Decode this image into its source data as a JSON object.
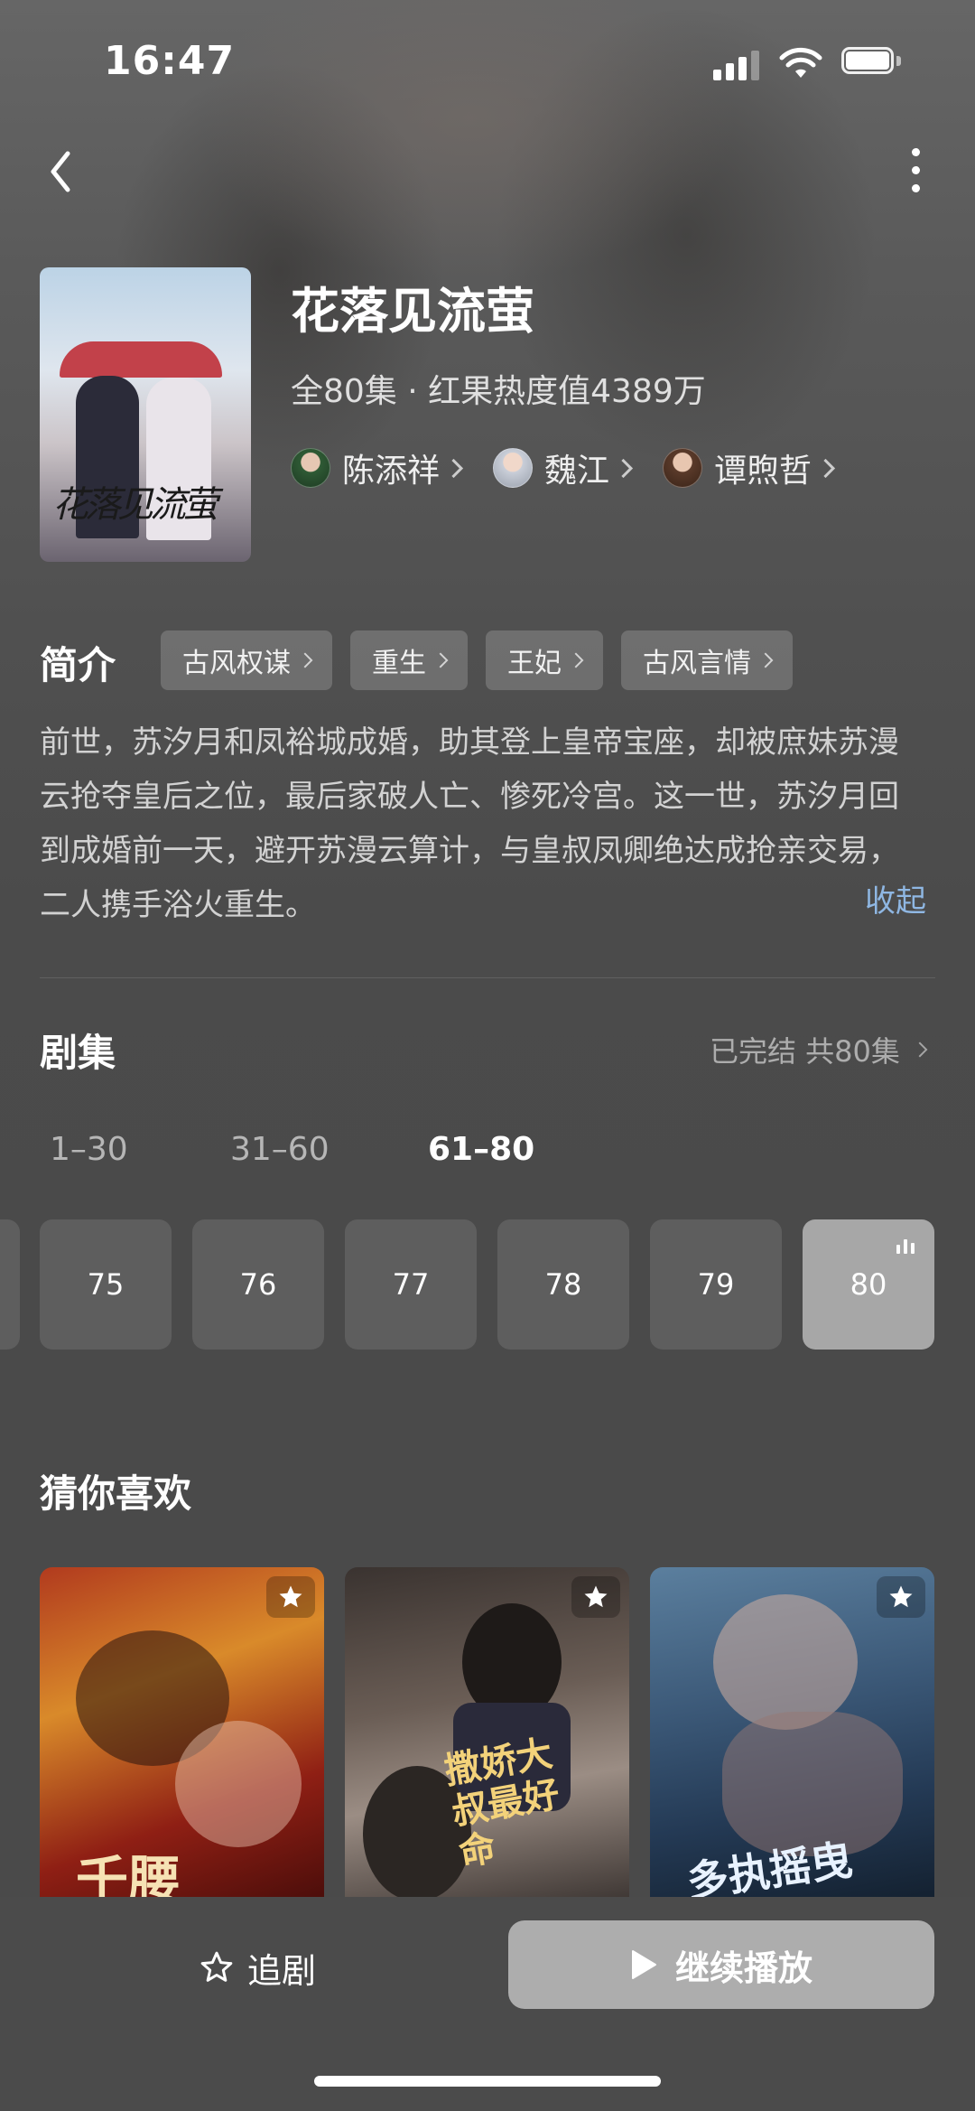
{
  "status_bar": {
    "time": "16:47"
  },
  "show": {
    "title": "花落见流萤",
    "meta": "全80集 · 红果热度值4389万",
    "poster_calligraphy": "花落见流萤",
    "cast": [
      {
        "name": "陈添祥"
      },
      {
        "name": "魏江"
      },
      {
        "name": "谭煦哲"
      }
    ]
  },
  "intro": {
    "label": "简介",
    "tags": [
      "古风权谋",
      "重生",
      "王妃",
      "古风言情"
    ],
    "synopsis": "前世，苏汐月和凤裕城成婚，助其登上皇帝宝座，却被庶妹苏漫云抢夺皇后之位，最后家破人亡、惨死冷宫。这一世，苏汐月回到成婚前一天，避开苏漫云算计，与皇叔凤卿绝达成抢亲交易，二人携手浴火重生。",
    "collapse": "收起"
  },
  "episodes": {
    "title": "剧集",
    "status": "已完结 共80集",
    "ranges": [
      "1–30",
      "31–60",
      "61–80"
    ],
    "active_range": "61–80",
    "buttons": [
      "75",
      "76",
      "77",
      "78",
      "79",
      "80"
    ],
    "current": "80"
  },
  "recommend": {
    "title": "猜你喜欢",
    "cards": [
      {
        "text": "千腰"
      },
      {
        "text": "撒娇大叔最好命"
      },
      {
        "text": "多执摇曳"
      }
    ]
  },
  "actions": {
    "follow": "追剧",
    "play": "继续播放"
  },
  "colors": {
    "accent_link": "#8fb7e3",
    "background": "#4a4a4a",
    "episode_button": "#5e5e5e",
    "episode_current": "#a7a7a7",
    "play_button": "#adadad"
  }
}
